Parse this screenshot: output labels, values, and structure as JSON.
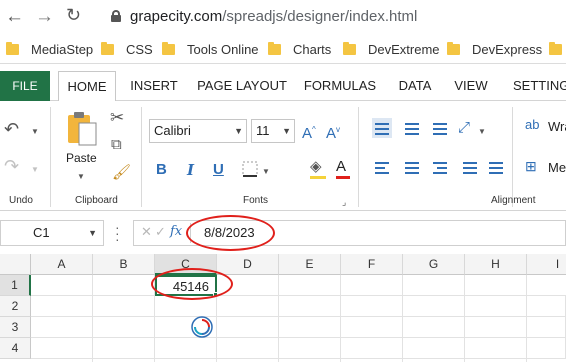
{
  "browser": {
    "url_host": "grapecity.com",
    "url_path": "/spreadjs/designer/index.html",
    "bookmarks": [
      "MediaStep",
      "CSS",
      "Tools Online",
      "Charts",
      "DevExtreme",
      "DevExpress"
    ]
  },
  "ribbon": {
    "tabs": [
      "FILE",
      "HOME",
      "INSERT",
      "PAGE LAYOUT",
      "FORMULAS",
      "DATA",
      "VIEW",
      "SETTINGS"
    ],
    "active_tab": "HOME",
    "groups": {
      "undo": "Undo",
      "clipboard": "Clipboard",
      "fonts": "Fonts",
      "alignment": "Alignment"
    },
    "paste_label": "Paste",
    "font_name": "Calibri",
    "font_size": "11",
    "wrap_label": "Wra",
    "merge_label": "Me"
  },
  "formula_bar": {
    "name_box": "C1",
    "fx_label": "fx",
    "formula_value": "8/8/2023"
  },
  "sheet": {
    "columns": [
      "A",
      "B",
      "C",
      "D",
      "E",
      "F",
      "G",
      "H",
      "I"
    ],
    "rows": [
      "1",
      "2",
      "3",
      "4"
    ],
    "active_column": "C",
    "active_row": "1",
    "cells": {
      "C1": "45146"
    }
  },
  "colors": {
    "file_tab": "#217346",
    "selection": "#217346",
    "annotation": "#e0201b",
    "accent_blue": "#2f6eb5"
  }
}
